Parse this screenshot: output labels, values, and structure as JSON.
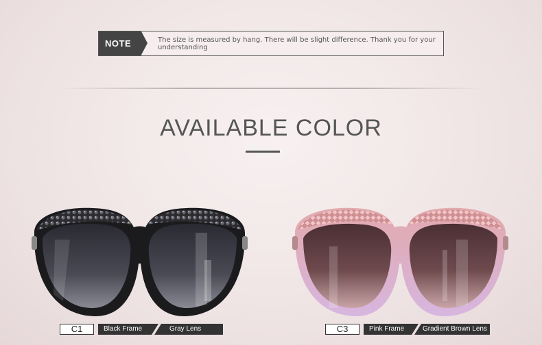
{
  "note": {
    "tag": "NOTE",
    "text": "The size is measured by hang. There will be slight difference. Thank you for your understanding"
  },
  "section": {
    "title": "AVAILABLE COLOR"
  },
  "variants": [
    {
      "code": "C1",
      "frame": "Black Frame",
      "lens": "Gray Lens",
      "frame_color": "#1c1c1f",
      "lens_color": "#3a3a44"
    },
    {
      "code": "C3",
      "frame": "Pink Frame",
      "lens": "Gradient Brown Lens",
      "frame_color": "#d9a3a8",
      "lens_color": "#5e3d40"
    }
  ]
}
